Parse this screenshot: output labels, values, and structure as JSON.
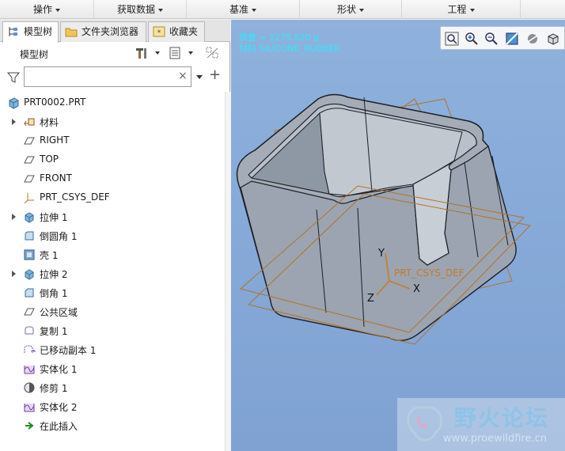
{
  "menu": [
    {
      "label": "操作"
    },
    {
      "label": "获取数据"
    },
    {
      "label": "基准"
    },
    {
      "label": "形状"
    },
    {
      "label": "工程"
    }
  ],
  "tabs": [
    {
      "label": "模型树",
      "active": true
    },
    {
      "label": "文件夹浏览器",
      "active": false
    },
    {
      "label": "收藏夹",
      "active": false
    }
  ],
  "tree_header": {
    "title": "模型树"
  },
  "filter": {
    "value": "",
    "clear_symbol": "×",
    "add_symbol": "+"
  },
  "tree": {
    "root": {
      "label": "PRT0002.PRT",
      "icon": "part-icon"
    },
    "items": [
      {
        "label": "材料",
        "icon": "material-icon",
        "expandable": true
      },
      {
        "label": "RIGHT",
        "icon": "datum-plane-icon",
        "expandable": false
      },
      {
        "label": "TOP",
        "icon": "datum-plane-icon",
        "expandable": false
      },
      {
        "label": "FRONT",
        "icon": "datum-plane-icon",
        "expandable": false
      },
      {
        "label": "PRT_CSYS_DEF",
        "icon": "csys-icon",
        "expandable": false
      },
      {
        "label": "拉伸 1",
        "icon": "extrude-icon",
        "expandable": true
      },
      {
        "label": "倒圆角 1",
        "icon": "round-icon",
        "expandable": false
      },
      {
        "label": "壳 1",
        "icon": "shell-icon",
        "expandable": false
      },
      {
        "label": "拉伸 2",
        "icon": "extrude-icon",
        "expandable": true
      },
      {
        "label": "倒角 1",
        "icon": "chamfer-icon",
        "expandable": false
      },
      {
        "label": "公共区域",
        "icon": "datum-plane-icon",
        "expandable": false
      },
      {
        "label": "复制 1",
        "icon": "copy-icon",
        "expandable": false
      },
      {
        "label": "已移动副本 1",
        "icon": "moved-copy-icon",
        "expandable": false
      },
      {
        "label": "实体化 1",
        "icon": "solidify-icon",
        "expandable": false
      },
      {
        "label": "修剪 1",
        "icon": "trim-icon",
        "expandable": false
      },
      {
        "label": "实体化 2",
        "icon": "solidify-icon",
        "expandable": false
      },
      {
        "label": "在此插入",
        "icon": "insert-here-icon",
        "expandable": false
      }
    ]
  },
  "viewport": {
    "info_line1": "质量 = 1275.520 g",
    "info_line2": "材料 SILICONE_RUBBER",
    "csys_label": "PRT_CSYS_DEF",
    "axis_x": "X",
    "axis_y": "Y",
    "axis_z": "Z"
  },
  "watermark": {
    "title": "野火论坛",
    "url": "www.proewildfire.cn"
  },
  "colors": {
    "viewport_bg": "#86a9d8",
    "model_body": "#a4acb7",
    "datum_plane": "#b5722a",
    "info_text": "#2ee8ff"
  }
}
